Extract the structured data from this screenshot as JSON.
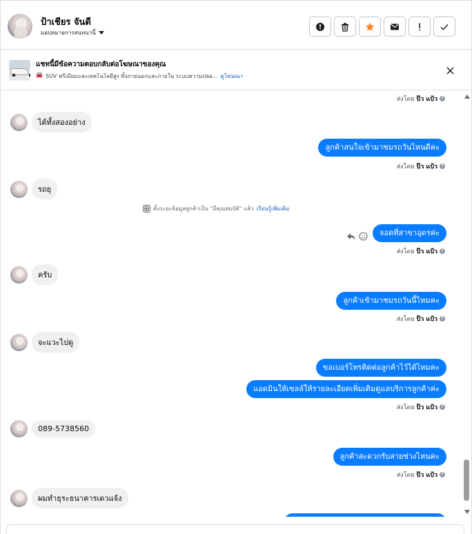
{
  "header": {
    "contact_name": "ป้าเชียร จันดี",
    "assign_label": "มอบหมายการสนทนานี้",
    "actions": [
      "mark-spam",
      "delete",
      "star",
      "mark-unread",
      "follow-up",
      "done"
    ]
  },
  "ad_banner": {
    "title": "แชทนี้มีข้อความตอบกลับต่อโฆษณาของคุณ",
    "subtitle": "SUV พรีเมียมและเทคโนโลยีสูง ทั้งภายนอกและภายใน ระบบความปลอ...",
    "link": "ดูโฆษณา"
  },
  "thread": {
    "sent_prefix": "ส่งโดย",
    "sender": "ป๊ว แป้ว",
    "messages": [
      {
        "dir": "in",
        "text": "ได้ทั้งสองอย่าง"
      },
      {
        "dir": "out",
        "text": "ลูกค้าสนใจเข้ามาชมรถวันไหนดีคะ"
      },
      {
        "dir": "in",
        "text": "รถยุ"
      },
      {
        "dir": "system",
        "text": "ตั้งระยะข้อมูลลูกค้าเป็น \"มีคุณสมบัติ\" แล้ว",
        "link": "เรียนรู้เพิ่มเติม"
      },
      {
        "dir": "out",
        "text": "จอดที่สาขาอุดรค่ะ"
      },
      {
        "dir": "in",
        "text": "ครับ"
      },
      {
        "dir": "out",
        "text": "ลูกค้าเข้ามาชมรถวันนี้ไหมคะ"
      },
      {
        "dir": "in",
        "text": "จะแวะไปดู"
      },
      {
        "dir": "out",
        "text": "ขอเบอร์โทรติดต่อลูกค้าไว้ได้ไหมคะ"
      },
      {
        "dir": "out",
        "text": "แอดมินให้เซลล์ให้รายละเอียดเพิ่มเติมดูแลบริการลูกค้าค่ะ"
      },
      {
        "dir": "in",
        "text": "089-5738560"
      },
      {
        "dir": "out",
        "text": "ลูกค้าสะดวกรับสายช่วงไหนคะ"
      },
      {
        "dir": "in",
        "text": "ผมทำธุระธนาคารเดวแจ้ง"
      }
    ]
  },
  "colors": {
    "outgoing_bubble": "#0a7cff",
    "incoming_bubble": "#f0f0f0",
    "star": "#f5821f"
  }
}
